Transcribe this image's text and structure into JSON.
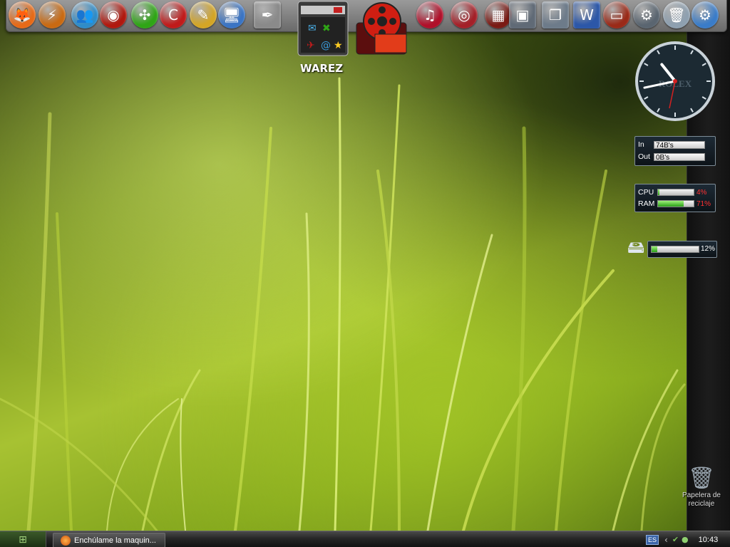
{
  "dock": {
    "items": [
      {
        "name": "firefox",
        "glyph": "🦊",
        "color": "#e66a17"
      },
      {
        "name": "download-accelerator",
        "glyph": "⚡",
        "color": "#c96a12"
      },
      {
        "name": "messenger",
        "glyph": "👥",
        "color": "#2f8cc8"
      },
      {
        "name": "media-player",
        "glyph": "◉",
        "color": "#b0180e"
      },
      {
        "name": "limewire",
        "glyph": "✣",
        "color": "#2fa516"
      },
      {
        "name": "ccleaner",
        "glyph": "C",
        "color": "#c01b1b"
      },
      {
        "name": "paint-tools",
        "glyph": "✎",
        "color": "#d4a526"
      },
      {
        "name": "computer",
        "glyph": "🖥",
        "color": "#3a74c4"
      },
      {
        "name": "notepad",
        "glyph": "✒",
        "color": "#8a8a8a"
      },
      {
        "name": "music",
        "glyph": "♫",
        "color": "#b0102a"
      },
      {
        "name": "dvd-burner",
        "glyph": "◎",
        "color": "#a42028"
      },
      {
        "name": "picture-viewer",
        "glyph": "▦",
        "color": "#7a1a14"
      },
      {
        "name": "window",
        "glyph": "▣",
        "color": "#606a76"
      },
      {
        "name": "documents",
        "glyph": "❐",
        "color": "#6d7b8a"
      },
      {
        "name": "word",
        "glyph": "W",
        "color": "#2c57a8"
      },
      {
        "name": "laptop",
        "glyph": "▭",
        "color": "#9a2a18"
      },
      {
        "name": "settings",
        "glyph": "⚙",
        "color": "#5a6570"
      },
      {
        "name": "recycle-bin",
        "glyph": "🗑",
        "color": "#8ea0b0"
      },
      {
        "name": "control-panel",
        "glyph": "⚙",
        "color": "#3a7cc8"
      },
      {
        "name": "windows-start",
        "glyph": "⊞",
        "color": "#2a5ca8"
      }
    ],
    "warez_label": "WAREZ"
  },
  "clock": {
    "brand": "ROLEX",
    "hour": 10,
    "minute": 43
  },
  "net": {
    "in_label": "In",
    "in_value": "74B's",
    "out_label": "Out",
    "out_value": "0B's"
  },
  "sys": {
    "cpu_label": "CPU",
    "cpu_pct": "4%",
    "cpu_value": 0.04,
    "ram_label": "RAM",
    "ram_pct": "71%",
    "ram_value": 0.71
  },
  "disk": {
    "pct": "12%",
    "value": 0.12
  },
  "desktop": {
    "recycle_label": "Papelera de reciclaje"
  },
  "taskbar": {
    "task_title": "Enchúlame la maquin...",
    "lang": "ES",
    "time": "10:43"
  }
}
